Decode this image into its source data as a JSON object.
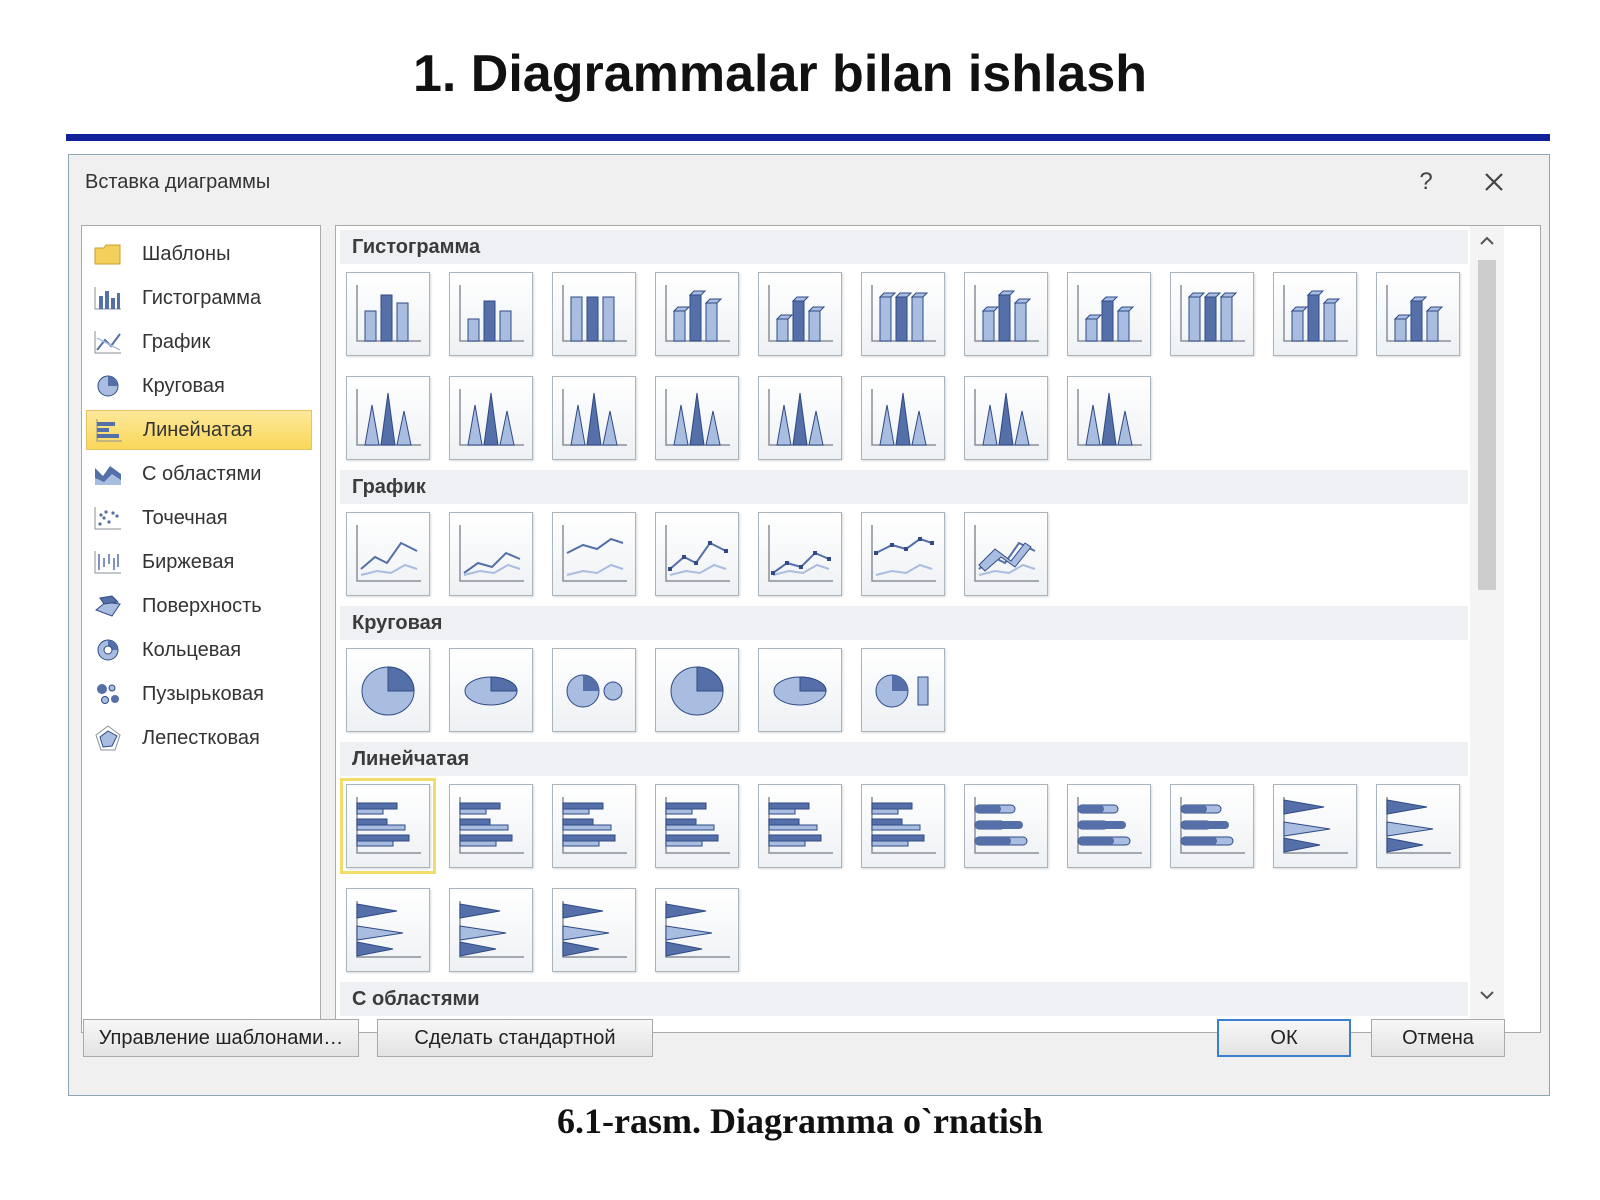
{
  "slide": {
    "title": "1. Diagrammalar bilan ishlash",
    "caption": "6.1-rasm. Diagramma o`rnatish"
  },
  "dialog": {
    "title": "Вставка диаграммы",
    "help_label": "?",
    "close_icon": "close-icon",
    "sidebar": {
      "items": [
        {
          "label": "Шаблоны",
          "icon": "folder-icon",
          "selected": false
        },
        {
          "label": "Гистограмма",
          "icon": "column-chart-icon",
          "selected": false
        },
        {
          "label": "График",
          "icon": "line-chart-icon",
          "selected": false
        },
        {
          "label": "Круговая",
          "icon": "pie-chart-icon",
          "selected": false
        },
        {
          "label": "Линейчатая",
          "icon": "bar-chart-icon",
          "selected": true
        },
        {
          "label": "С областями",
          "icon": "area-chart-icon",
          "selected": false
        },
        {
          "label": "Точечная",
          "icon": "scatter-chart-icon",
          "selected": false
        },
        {
          "label": "Биржевая",
          "icon": "stock-chart-icon",
          "selected": false
        },
        {
          "label": "Поверхность",
          "icon": "surface-chart-icon",
          "selected": false
        },
        {
          "label": "Кольцевая",
          "icon": "doughnut-chart-icon",
          "selected": false
        },
        {
          "label": "Пузырьковая",
          "icon": "bubble-chart-icon",
          "selected": false
        },
        {
          "label": "Лепестковая",
          "icon": "radar-chart-icon",
          "selected": false
        }
      ]
    },
    "sections": [
      {
        "label": "Гистограмма",
        "thumbs": [
          {
            "icon": "clustered-column-icon"
          },
          {
            "icon": "stacked-column-icon"
          },
          {
            "icon": "percent-stacked-column-icon"
          },
          {
            "icon": "3d-clustered-column-icon"
          },
          {
            "icon": "3d-stacked-column-icon"
          },
          {
            "icon": "3d-percent-stacked-column-icon"
          },
          {
            "icon": "3d-column-icon"
          },
          {
            "icon": "clustered-cylinder-icon"
          },
          {
            "icon": "stacked-cylinder-icon"
          },
          {
            "icon": "percent-stacked-cylinder-icon"
          },
          {
            "icon": "3d-cylinder-icon"
          },
          {
            "icon": "clustered-cone-icon"
          },
          {
            "icon": "stacked-cone-icon"
          },
          {
            "icon": "percent-stacked-cone-icon"
          },
          {
            "icon": "3d-cone-icon"
          },
          {
            "icon": "clustered-pyramid-icon"
          },
          {
            "icon": "stacked-pyramid-icon"
          },
          {
            "icon": "percent-stacked-pyramid-icon"
          },
          {
            "icon": "3d-pyramid-icon"
          }
        ]
      },
      {
        "label": "График",
        "thumbs": [
          {
            "icon": "line-icon"
          },
          {
            "icon": "stacked-line-icon"
          },
          {
            "icon": "percent-stacked-line-icon"
          },
          {
            "icon": "line-with-markers-icon"
          },
          {
            "icon": "stacked-line-with-markers-icon"
          },
          {
            "icon": "percent-stacked-line-with-markers-icon"
          },
          {
            "icon": "3d-line-icon"
          }
        ]
      },
      {
        "label": "Круговая",
        "thumbs": [
          {
            "icon": "pie-icon"
          },
          {
            "icon": "3d-pie-icon"
          },
          {
            "icon": "pie-of-pie-icon"
          },
          {
            "icon": "exploded-pie-icon"
          },
          {
            "icon": "exploded-3d-pie-icon"
          },
          {
            "icon": "bar-of-pie-icon"
          }
        ]
      },
      {
        "label": "Линейчатая",
        "thumbs": [
          {
            "icon": "clustered-bar-icon",
            "selected": true
          },
          {
            "icon": "stacked-bar-icon"
          },
          {
            "icon": "percent-stacked-bar-icon"
          },
          {
            "icon": "3d-clustered-bar-icon"
          },
          {
            "icon": "3d-stacked-bar-icon"
          },
          {
            "icon": "3d-percent-stacked-bar-icon"
          },
          {
            "icon": "clustered-horizontal-cylinder-icon"
          },
          {
            "icon": "stacked-horizontal-cylinder-icon"
          },
          {
            "icon": "percent-stacked-horizontal-cylinder-icon"
          },
          {
            "icon": "clustered-horizontal-cone-icon"
          },
          {
            "icon": "stacked-horizontal-cone-icon"
          },
          {
            "icon": "percent-stacked-horizontal-cone-icon"
          },
          {
            "icon": "clustered-horizontal-pyramid-icon"
          },
          {
            "icon": "stacked-horizontal-pyramid-icon"
          },
          {
            "icon": "percent-stacked-horizontal-pyramid-icon"
          }
        ]
      },
      {
        "label": "С областями",
        "thumbs": []
      }
    ],
    "buttons": {
      "manage_templates": "Управление шаблонами…",
      "set_default": "Сделать стандартной",
      "ok": "ОК",
      "cancel": "Отмена"
    },
    "colors": {
      "accent": "#5570a8",
      "selection": "#f9d75a",
      "rule": "#12229a"
    }
  }
}
